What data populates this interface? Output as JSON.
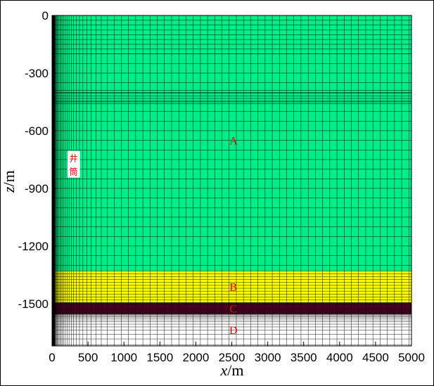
{
  "chart_data": {
    "type": "mesh",
    "xlabel": {
      "italic": "x",
      "unit": "/m"
    },
    "ylabel": {
      "italic": "z",
      "unit": "/m"
    },
    "xlim": [
      0,
      5000
    ],
    "ylim": [
      -1720,
      0
    ],
    "xticks": [
      0,
      500,
      1000,
      1500,
      2000,
      2500,
      3000,
      3500,
      4000,
      4500,
      5000
    ],
    "yticks": [
      0,
      -300,
      -600,
      -900,
      -1200,
      -1500
    ],
    "regions": [
      {
        "name": "A",
        "z_top": 0,
        "z_bottom": -1330,
        "color": "#00ee88"
      },
      {
        "name": "B",
        "z_top": -1330,
        "z_bottom": -1495,
        "color": "#ffff00"
      },
      {
        "name": "C",
        "z_top": -1495,
        "z_bottom": -1555,
        "color": "#6a0035"
      },
      {
        "name": "D",
        "z_top": -1555,
        "z_bottom": -1720,
        "color": "#ffffff"
      }
    ],
    "region_labels": [
      {
        "text": "A",
        "x": 2600,
        "z": -650
      },
      {
        "text": "B",
        "x": 2600,
        "z": -1410
      },
      {
        "text": "C",
        "x": 2600,
        "z": -1525
      },
      {
        "text": "D",
        "x": 2600,
        "z": -1635
      }
    ],
    "wellbore": {
      "label_line1": "井",
      "label_line2": "筒",
      "x": 300,
      "z": -800
    },
    "colors": {
      "label": "#ee0000",
      "grid": "#000000"
    }
  }
}
